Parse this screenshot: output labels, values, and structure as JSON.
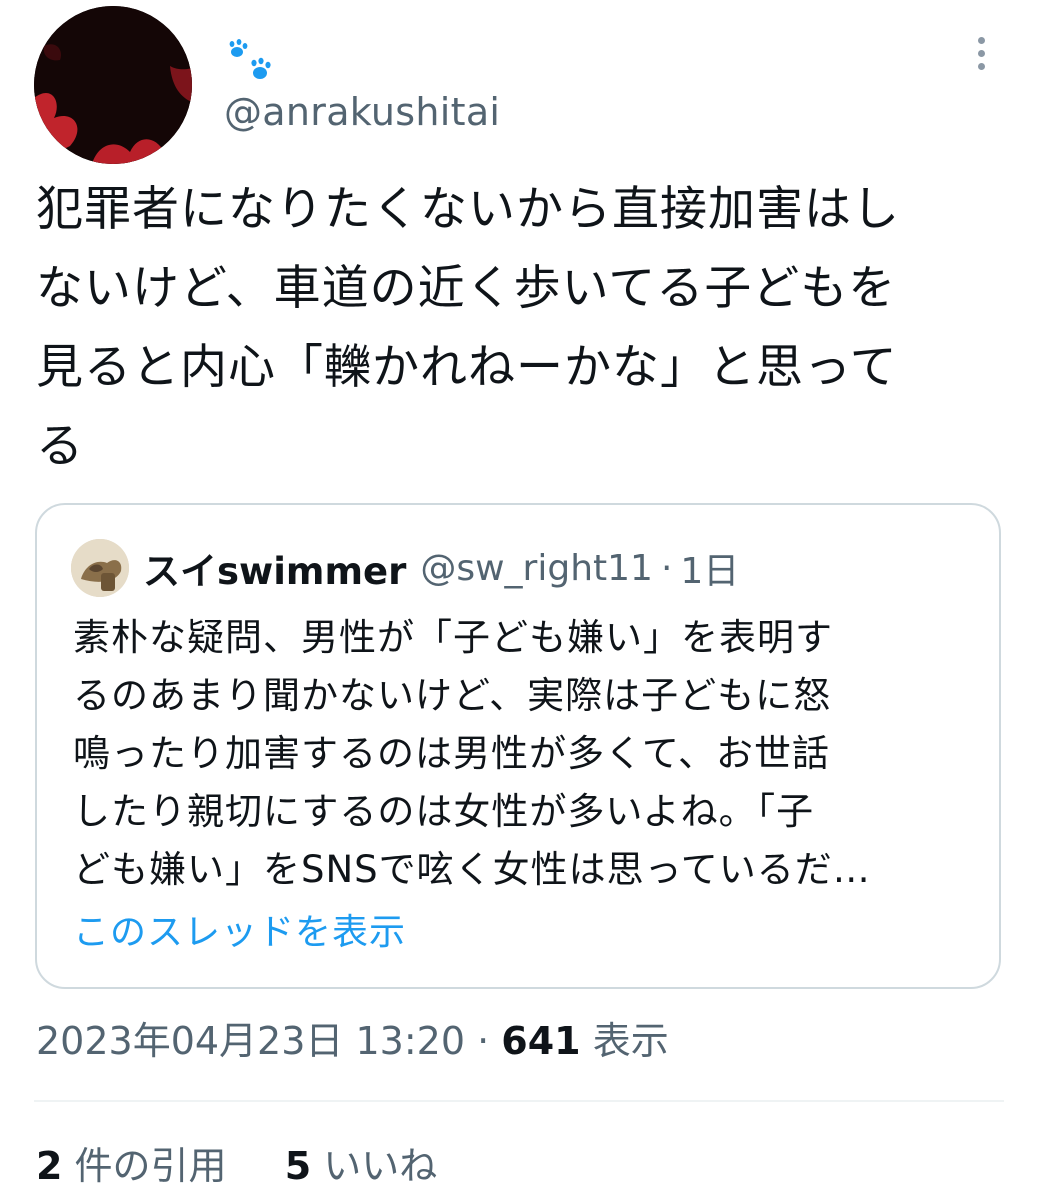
{
  "author": {
    "display_name_icon": "paw-prints-icon",
    "handle": "@anrakushitai"
  },
  "tweet": {
    "text_lines": [
      "犯罪者になりたくないから直接加害はし",
      "ないけど、車道の近く歩いてる子どもを",
      "見ると内心「轢かれねーかな」と思って",
      "る"
    ]
  },
  "quoted_tweet": {
    "name": "スイswimmer",
    "handle": "@sw_right11",
    "separator": "·",
    "time": "1日",
    "text_lines": [
      "素朴な疑問、男性が「子ども嫌い」を表明す",
      "るのあまり聞かないけど、実際は子どもに怒",
      "鳴ったり加害するのは男性が多くて、お世話",
      "したり親切にするのは女性が多いよね。「子",
      "ども嫌い」をSNSで呟く女性は思っているだ…"
    ],
    "show_thread_label": "このスレッドを表示"
  },
  "meta": {
    "timestamp": "2023年04月23日 13:20",
    "separator": "·",
    "views_count": "641",
    "views_label": "表示"
  },
  "stats": {
    "quotes_count": "2",
    "quotes_label": "件の引用",
    "likes_count": "5",
    "likes_label": "いいね"
  },
  "colors": {
    "text_primary": "#0f1419",
    "text_secondary": "#536471",
    "link": "#1d9bf0",
    "border": "#cfd9de",
    "paw": "#1d9bf0"
  }
}
